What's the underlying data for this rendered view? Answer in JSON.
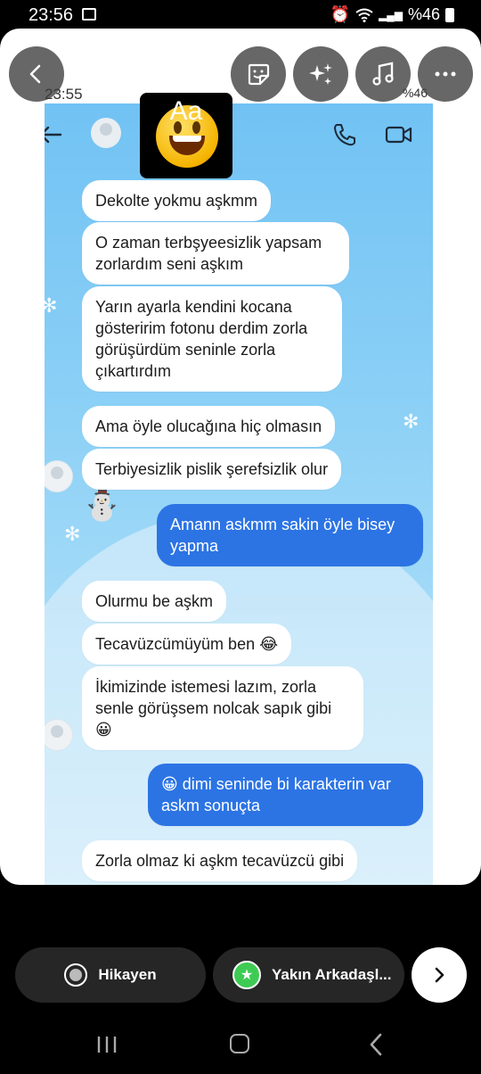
{
  "status_bar": {
    "time": "23:56",
    "right_text": "%46"
  },
  "screenshot": {
    "status_time": "23:55",
    "status_right": "%46",
    "messages": [
      {
        "dir": "in",
        "text": "Dekolte yokmu aşkmm"
      },
      {
        "dir": "in",
        "text": "O zaman terbşyeesizlik yapsam zorlardım seni aşkım"
      },
      {
        "dir": "in",
        "text": "Yarın ayarla kendini kocana gösteririm fotonu derdim zorla görüşürdüm seninle zorla çıkartırdım"
      },
      {
        "dir": "in",
        "text": "Ama öyle olucağına hiç olmasın"
      },
      {
        "dir": "in",
        "text": "Terbiyesizlik pislik şerefsizlik olur"
      },
      {
        "dir": "out",
        "text": "Amann askmm sakin öyle bisey yapma"
      },
      {
        "dir": "in",
        "text": "Olurmu be aşkm"
      },
      {
        "dir": "in",
        "text": "Tecavüzcümüyüm ben 😂"
      },
      {
        "dir": "in",
        "text": "İkimizinde istemesi lazım, zorla senle görüşsem nolcak sapık gibi 😀"
      },
      {
        "dir": "out",
        "text": "😀 dimi seninde bi karakterin var askm sonuçta"
      },
      {
        "dir": "in",
        "text": "Zorla olmaz ki aşkm tecavüzcü gibi"
      }
    ]
  },
  "toolbar": {
    "back_icon": "chevron-left-icon",
    "text_label": "Aa",
    "sticker_icon": "sticker-icon",
    "effects_icon": "sparkles-icon",
    "music_icon": "music-note-icon",
    "more_icon": "more-horizontal-icon"
  },
  "share_bar": {
    "story_label": "Hikayen",
    "close_friends_label": "Yakın Arkadaşl...",
    "next_icon": "chevron-right-icon"
  },
  "colors": {
    "outgoing_bubble": "#2c74e4",
    "incoming_bubble": "#ffffff",
    "chat_background": "#8bd0f6",
    "close_friends_green": "#3ecb54"
  }
}
